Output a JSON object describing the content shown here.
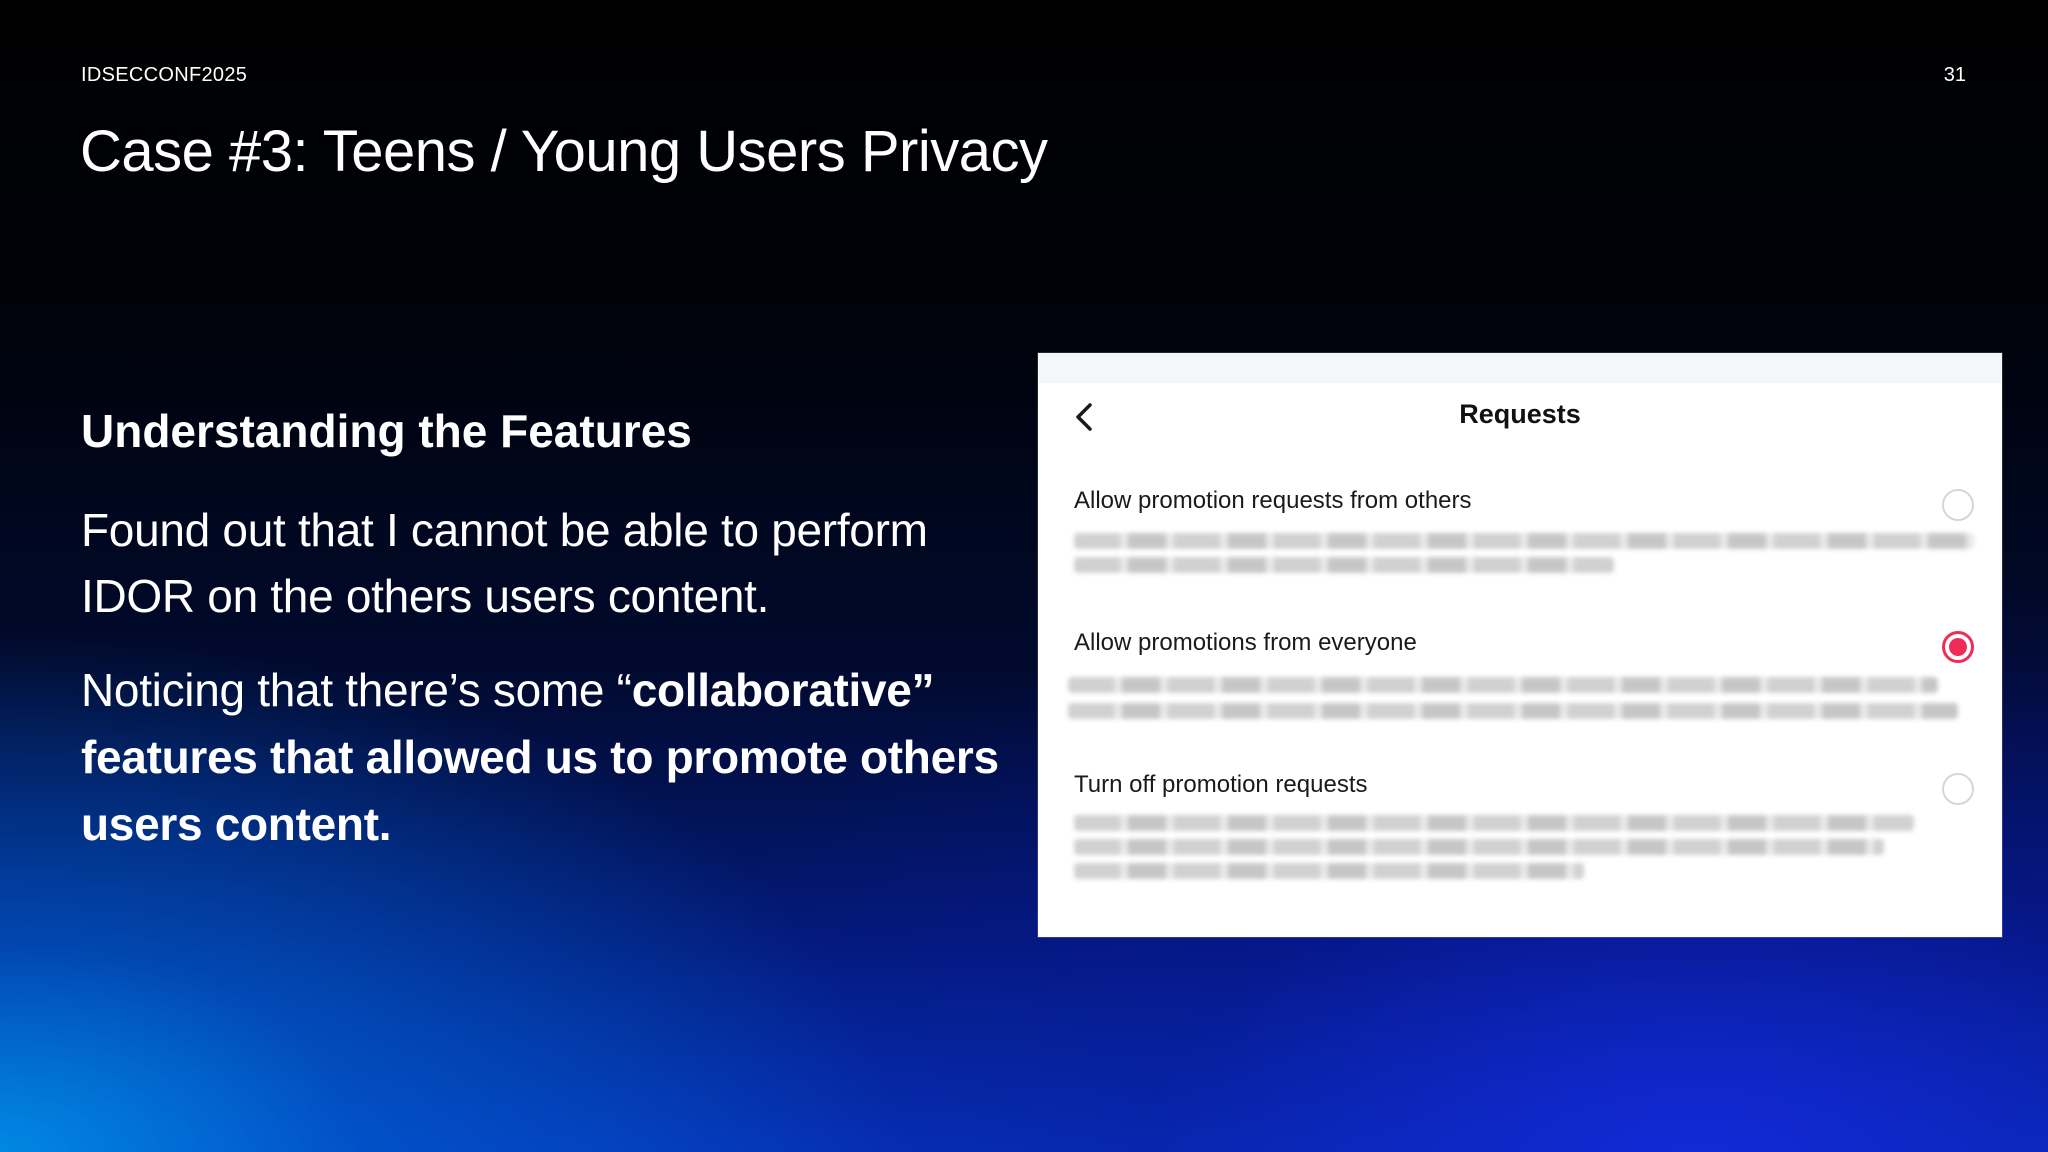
{
  "slide": {
    "conference": "IDSECCONF2025",
    "page_number": "31",
    "title": "Case #3: Teens / Young Users Privacy",
    "section_heading": "Understanding the Features",
    "paragraph1": "Found out that I cannot be able to perform IDOR on the others users content.",
    "paragraph2_plain": "Noticing that there’s some “",
    "paragraph2_bold": "collaborative” features that allowed us to promote others users content."
  },
  "requests_panel": {
    "title": "Requests",
    "back_icon": "chevron-left-icon",
    "options": [
      {
        "label": "Allow promotion requests from others",
        "selected": false
      },
      {
        "label": "Allow promotions from everyone",
        "selected": true
      },
      {
        "label": "Turn off promotion requests",
        "selected": false
      }
    ],
    "accent_color": "#f02c56"
  }
}
